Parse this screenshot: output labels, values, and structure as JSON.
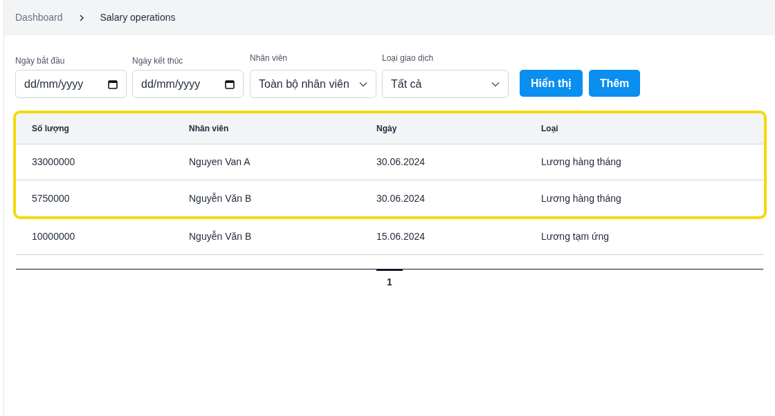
{
  "breadcrumb": [
    {
      "label": "Dashboard",
      "current": false
    },
    {
      "label": "Salary operations",
      "current": true
    }
  ],
  "filters": [
    {
      "kind": "date",
      "label": "Ngày bắt đầu",
      "placeholder": "dd/mm/yyyy"
    },
    {
      "kind": "date",
      "label": "Ngày kết thúc",
      "placeholder": "dd/mm/yyyy"
    },
    {
      "kind": "select",
      "label": "Nhân viên",
      "value": "Toàn bộ nhân viên"
    },
    {
      "kind": "select",
      "label": "Loại giao dịch",
      "value": "Tất cả"
    }
  ],
  "buttons": [
    "Hiển thị",
    "Thêm"
  ],
  "table": {
    "columns": [
      "Số lượng",
      "Nhân viên",
      "Ngày",
      "Loại"
    ],
    "highlighted_rows": [
      {
        "cells": [
          "33000000",
          "Nguyen Van A",
          "30.06.2024",
          "Lương hàng tháng"
        ]
      },
      {
        "cells": [
          "5750000",
          "Nguyễn Văn B",
          "30.06.2024",
          "Lương hàng tháng"
        ]
      }
    ],
    "rows": [
      {
        "cells": [
          "10000000",
          "Nguyễn Văn B",
          "15.06.2024",
          "Lương tạm ứng"
        ]
      }
    ]
  },
  "pagination": [
    {
      "label": "1",
      "selected": true
    }
  ]
}
